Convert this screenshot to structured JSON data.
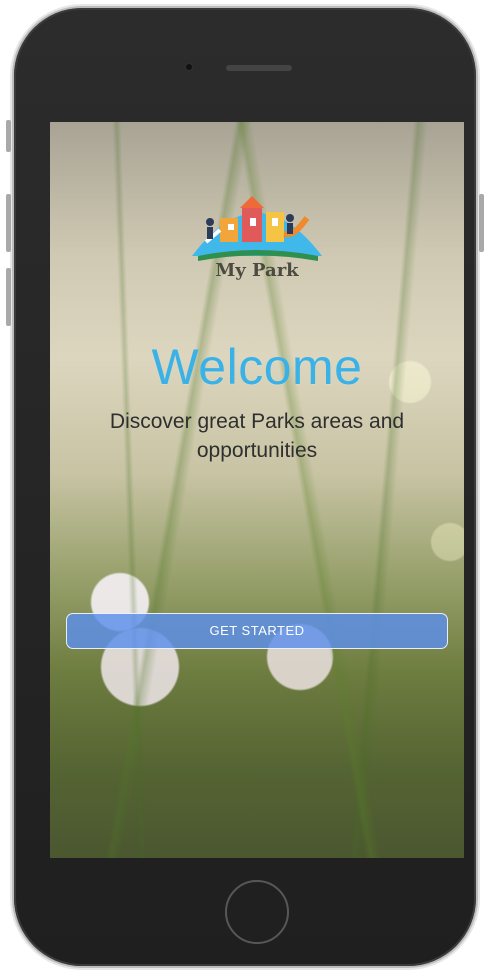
{
  "app": {
    "logo_text": "My Park",
    "welcome": "Welcome",
    "subtitle": "Discover great Parks areas and opportunities",
    "cta_label": "GET STARTED"
  },
  "colors": {
    "welcome": "#3ab2e8",
    "cta": "#5c8feb",
    "device": "#222222"
  },
  "icons": {
    "logo": "park-playground-logo",
    "camera": "camera-icon",
    "home": "home-button"
  }
}
